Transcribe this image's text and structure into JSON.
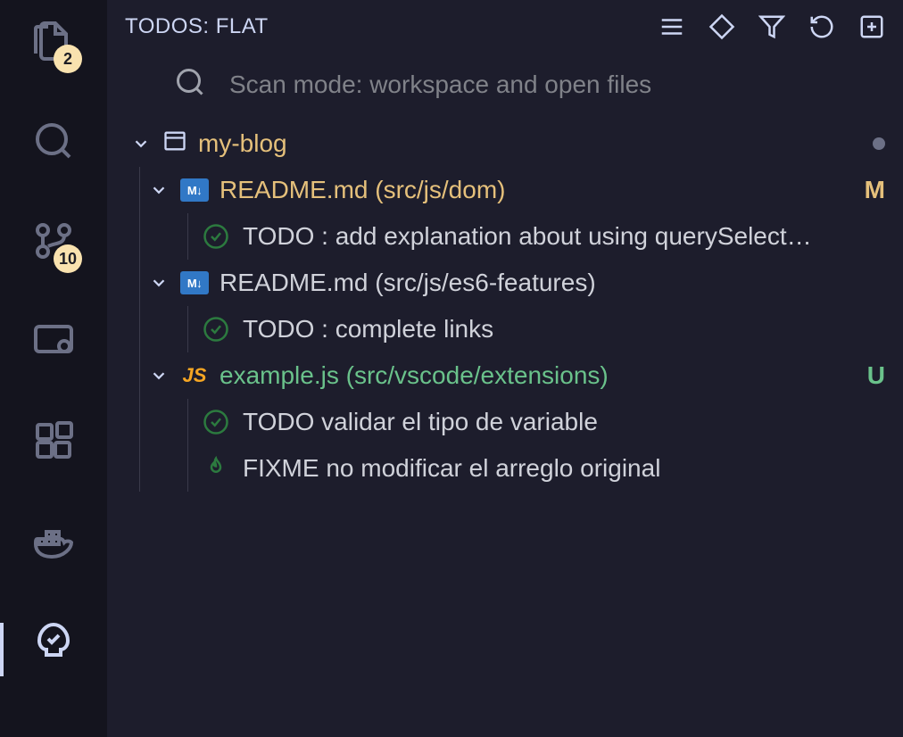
{
  "activityBar": {
    "items": [
      {
        "name": "explorer",
        "badge": "2"
      },
      {
        "name": "search"
      },
      {
        "name": "source-control",
        "badge": "10"
      },
      {
        "name": "remote"
      },
      {
        "name": "extensions"
      },
      {
        "name": "docker"
      },
      {
        "name": "todo-tree",
        "active": true
      }
    ]
  },
  "sidebar": {
    "title": "TODOS: FLAT",
    "actions": [
      "list",
      "tag",
      "filter",
      "refresh",
      "expand"
    ]
  },
  "search": {
    "placeholder": "Scan mode: workspace and open files"
  },
  "tree": {
    "root": {
      "label": "my-blog"
    },
    "files": [
      {
        "icon": "md",
        "name": "README.md",
        "path": "(src/js/dom)",
        "statusColor": "c-yellow",
        "scm": "M",
        "items": [
          {
            "icon": "check",
            "text": "TODO : add explanation about using querySelect…"
          }
        ]
      },
      {
        "icon": "md",
        "name": "README.md",
        "path": "(src/js/es6-features)",
        "statusColor": "c-default",
        "scm": "",
        "items": [
          {
            "icon": "check",
            "text": "TODO : complete links"
          }
        ]
      },
      {
        "icon": "js",
        "name": "example.js",
        "path": "(src/vscode/extensions)",
        "statusColor": "c-green",
        "scm": "U",
        "items": [
          {
            "icon": "check",
            "text": "TODO validar el tipo de variable"
          },
          {
            "icon": "flame",
            "text": "FIXME no modificar el arreglo original"
          }
        ]
      }
    ]
  },
  "icons": {
    "md": "M↓",
    "js": "JS"
  }
}
